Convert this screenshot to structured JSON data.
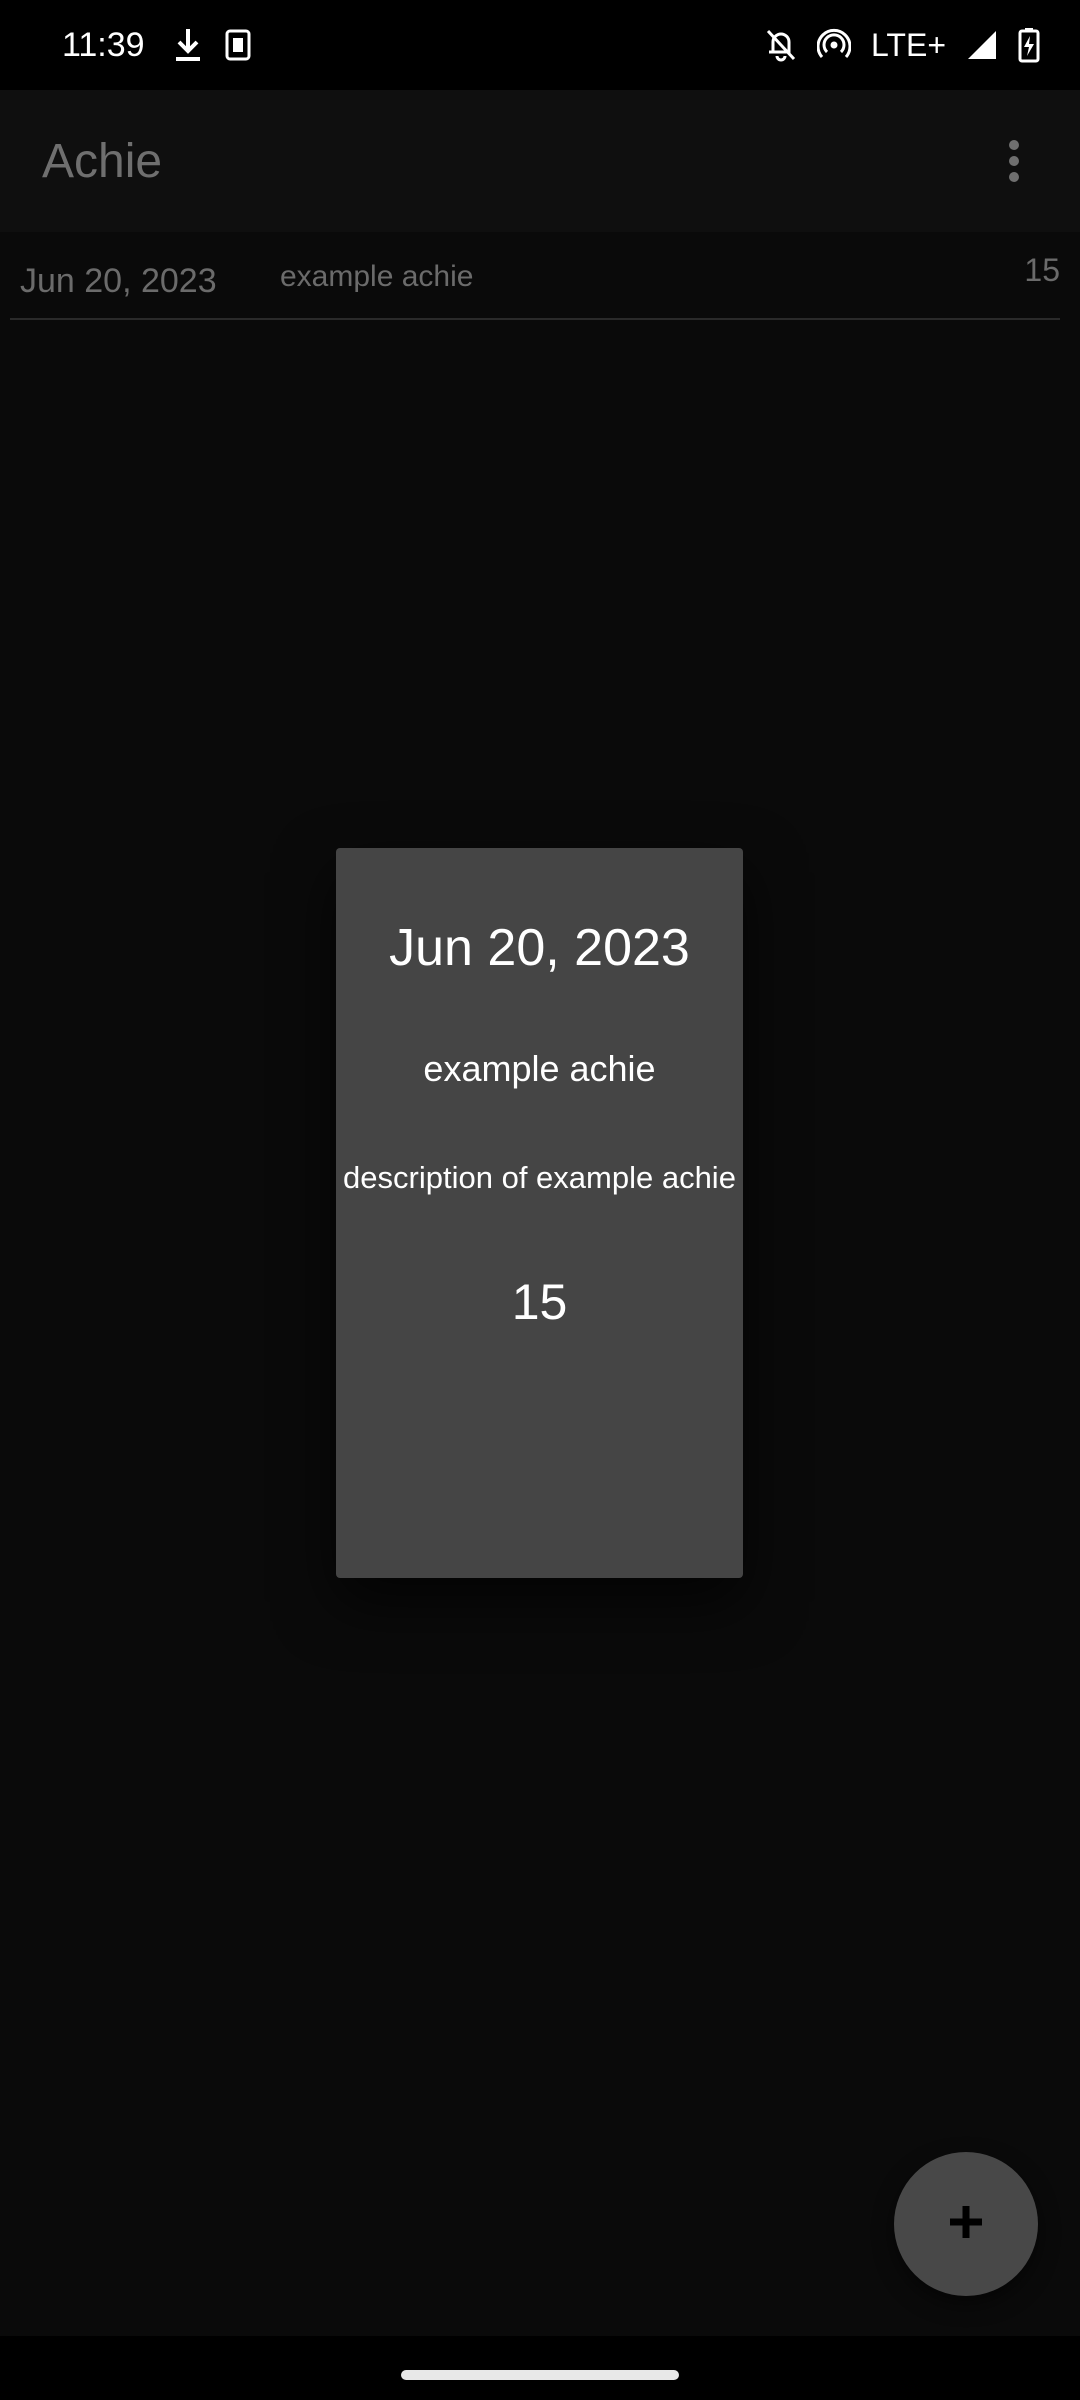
{
  "status_bar": {
    "time": "11:39",
    "network": "LTE+",
    "icons": [
      "download-icon",
      "sim-app-icon",
      "bell-off-icon",
      "hotspot-icon",
      "signal-icon",
      "battery-charging-icon"
    ]
  },
  "app_bar": {
    "title": "Achie",
    "menu_icon": "more-vert-icon"
  },
  "list": {
    "items": [
      {
        "date": "Jun 20, 2023",
        "name": "example achie",
        "points": "15"
      }
    ]
  },
  "dialog": {
    "date": "Jun 20, 2023",
    "name": "example achie",
    "description": "description of example achie",
    "points": "15"
  },
  "fab": {
    "icon": "plus-icon"
  },
  "colors": {
    "background": "#0a0a0a",
    "dialog": "#454545",
    "muted_text": "#6b6b6b",
    "fab": "#484848"
  }
}
